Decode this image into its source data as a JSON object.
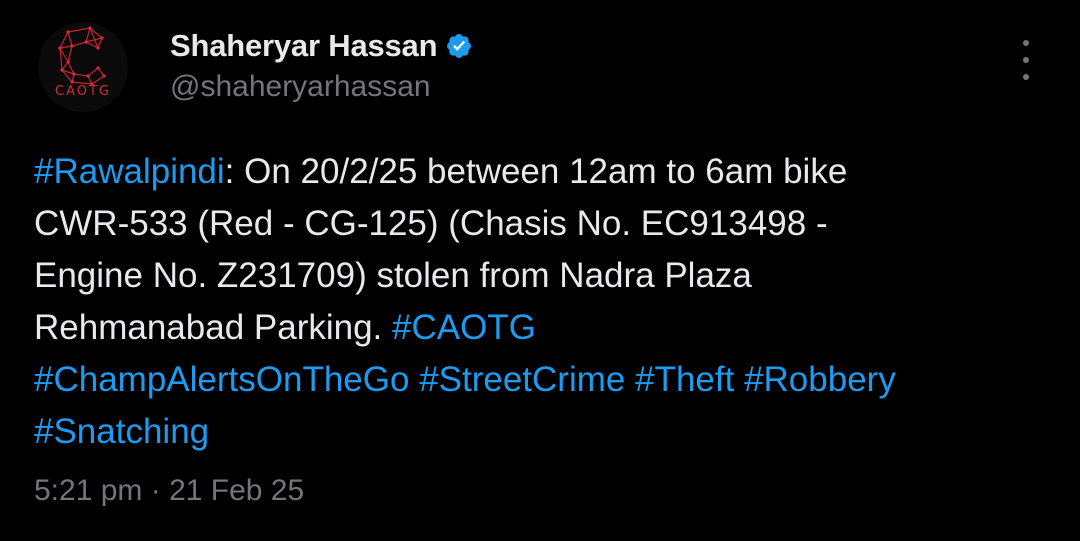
{
  "author": {
    "display_name": "Shaheryar Hassan",
    "handle": "@shaheryarhassan",
    "verified": true,
    "avatar_logo_text": "CAOTG"
  },
  "tweet": {
    "segments": [
      {
        "type": "hashtag",
        "text": "#Rawalpindi"
      },
      {
        "type": "text",
        "text": ": On 20/2/25 between 12am to 6am bike CWR-533 (Red - CG-125) (Chasis No. EC913498 - Engine No. Z231709) stolen from Nadra Plaza Rehmanabad Parking. "
      },
      {
        "type": "hashtag",
        "text": "#CAOTG"
      },
      {
        "type": "text",
        "text": " "
      },
      {
        "type": "hashtag",
        "text": "#ChampAlertsOnTheGo"
      },
      {
        "type": "text",
        "text": " "
      },
      {
        "type": "hashtag",
        "text": "#StreetCrime"
      },
      {
        "type": "text",
        "text": " "
      },
      {
        "type": "hashtag",
        "text": "#Theft"
      },
      {
        "type": "text",
        "text": " "
      },
      {
        "type": "hashtag",
        "text": "#Robbery"
      },
      {
        "type": "text",
        "text": " "
      },
      {
        "type": "hashtag",
        "text": "#Snatching"
      }
    ],
    "time": "5:21 pm",
    "separator": " · ",
    "date": "21 Feb 25"
  },
  "icons": {
    "verified": "verified-badge-icon",
    "more": "more-vertical-icon"
  },
  "colors": {
    "background": "#000000",
    "text": "#e7e9ea",
    "secondary": "#71767b",
    "link": "#1d9bf0",
    "verified": "#1d9bf0",
    "logo": "#d9263a"
  }
}
